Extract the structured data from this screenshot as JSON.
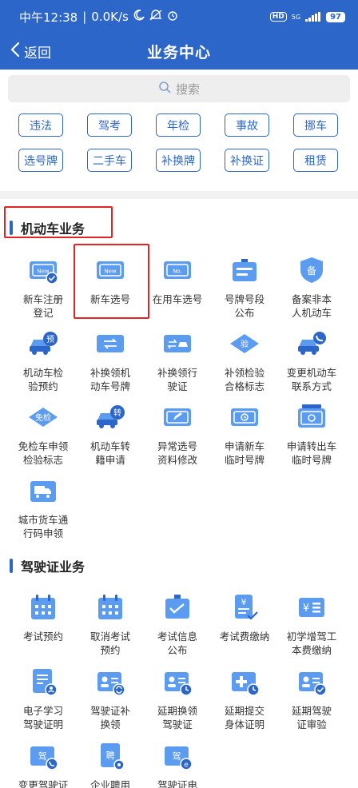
{
  "status": {
    "time": "中午12:38",
    "speed": "0.0K/s",
    "network": "5G",
    "battery": "97"
  },
  "nav": {
    "back_label": "返回",
    "title": "业务中心"
  },
  "search": {
    "placeholder": "搜索"
  },
  "quick_tags": [
    "违法",
    "驾考",
    "年检",
    "事故",
    "挪车",
    "选号牌",
    "二手车",
    "补换牌",
    "补换证",
    "租赁"
  ],
  "sections": {
    "vehicle": {
      "title": "机动车业务",
      "items": [
        {
          "label": "新车注册\n登记",
          "icon": "new-car-register-icon"
        },
        {
          "label": "新车选号",
          "icon": "new-plate-select-icon"
        },
        {
          "label": "在用车选号",
          "icon": "used-plate-select-icon"
        },
        {
          "label": "号牌号段\n公布",
          "icon": "plate-segment-announce-icon"
        },
        {
          "label": "备案非本\n人机动车",
          "icon": "record-shield-icon"
        },
        {
          "label": "机动车检\n验预约",
          "icon": "inspection-booking-icon"
        },
        {
          "label": "补换领机\n动车号牌",
          "icon": "plate-exchange-icon"
        },
        {
          "label": "补换领行\n驶证",
          "icon": "license-exchange-icon"
        },
        {
          "label": "补领检验\n合格标志",
          "icon": "inspection-mark-icon"
        },
        {
          "label": "变更机动车\n联系方式",
          "icon": "contact-change-icon"
        },
        {
          "label": "免检车申领\n检验标志",
          "icon": "exempt-mark-icon"
        },
        {
          "label": "机动车转\n籍申请",
          "icon": "transfer-icon"
        },
        {
          "label": "异常选号\n资料修改",
          "icon": "edit-plate-icon"
        },
        {
          "label": "申请新车\n临时号牌",
          "icon": "temp-plate-new-icon"
        },
        {
          "label": "申请转出车\n临时号牌",
          "icon": "temp-plate-out-icon"
        },
        {
          "label": "城市货车通\n行码申领",
          "icon": "truck-pass-icon"
        }
      ]
    },
    "driver": {
      "title": "驾驶证业务",
      "items": [
        {
          "label": "考试预约",
          "icon": "calendar-icon"
        },
        {
          "label": "取消考试\n预约",
          "icon": "calendar-cancel-icon"
        },
        {
          "label": "考试信息\n公布",
          "icon": "exam-info-icon"
        },
        {
          "label": "考试费缴纳",
          "icon": "exam-fee-icon"
        },
        {
          "label": "初学增驾工\n本费缴纳",
          "icon": "fee-pay-icon"
        },
        {
          "label": "电子学习\n驾驶证明",
          "icon": "e-learning-cert-icon"
        },
        {
          "label": "驾驶证补\n换领",
          "icon": "dl-exchange-icon"
        },
        {
          "label": "延期换领\n驾驶证",
          "icon": "delay-exchange-icon"
        },
        {
          "label": "延期提交\n身体证明",
          "icon": "delay-health-icon"
        },
        {
          "label": "延期驾驶\n证审验",
          "icon": "delay-review-icon"
        },
        {
          "label": "变更驾驶证\n联系方式",
          "icon": "dl-contact-change-icon"
        },
        {
          "label": "企业聘用",
          "icon": "employment-icon"
        },
        {
          "label": "驾驶证电\n子版",
          "icon": "e-license-icon"
        }
      ]
    }
  },
  "colors": {
    "primary": "#2c66c9",
    "light_blue": "#4a90e8",
    "highlight": "#e52525"
  }
}
